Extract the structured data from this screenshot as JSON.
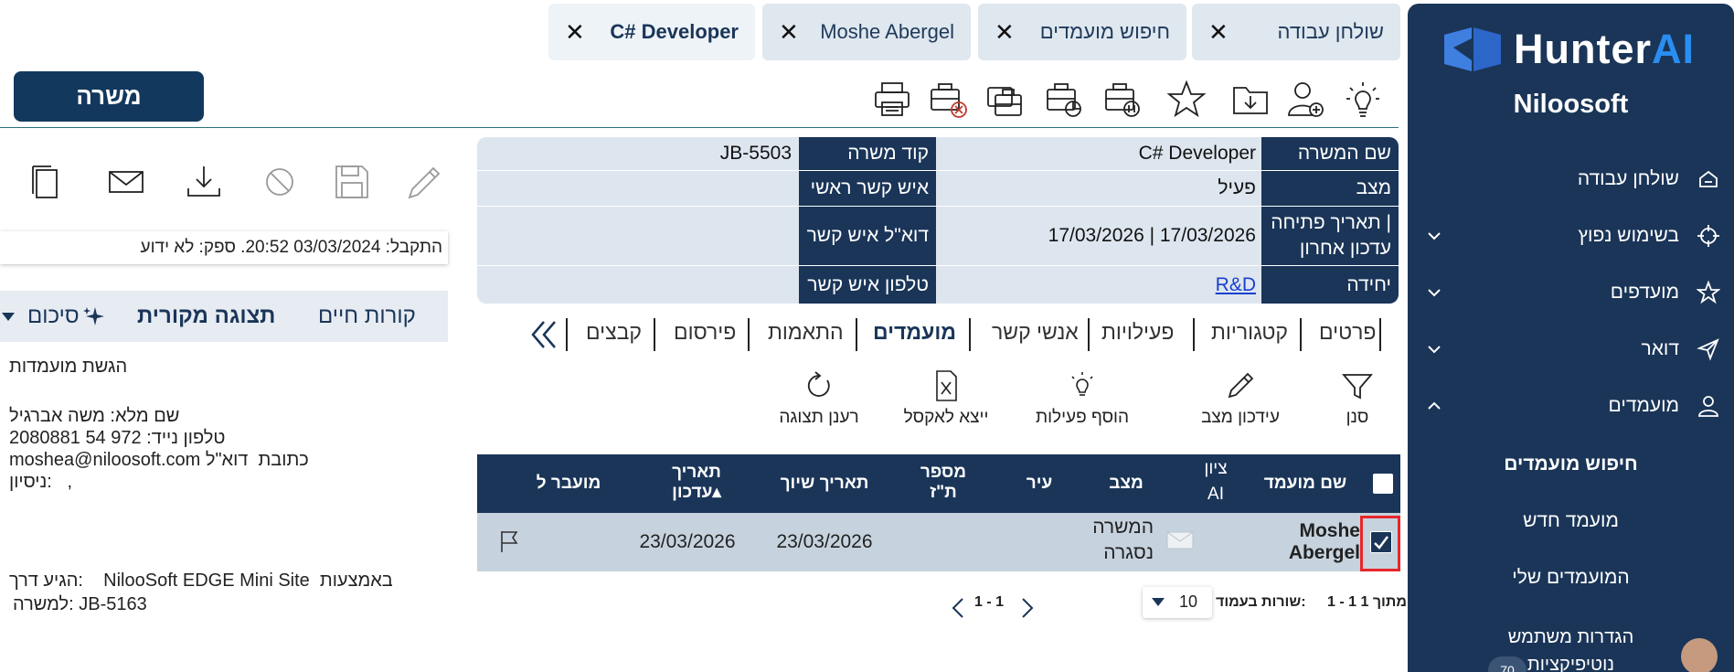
{
  "app": {
    "brand_main": "Hunter",
    "brand_ai": "AI",
    "org": "Niloosoft"
  },
  "sidebar": {
    "items": [
      {
        "label": "שולחן עבודה",
        "icon": "home-icon"
      },
      {
        "label": "בשימוש נפוץ",
        "icon": "crosshair-icon"
      },
      {
        "label": "מועדפים",
        "icon": "star-icon"
      },
      {
        "label": "דואר",
        "icon": "send-icon"
      },
      {
        "label": "מועמדים",
        "icon": "user-icon"
      }
    ],
    "subitems": [
      {
        "label": "חיפוש מועמדים"
      },
      {
        "label": "מועמד חדש"
      },
      {
        "label": "המועמדים שלי"
      }
    ],
    "user_settings": "הגדרות משתמש",
    "notifications": "נוטיפיקציות",
    "notifications_count": "70"
  },
  "tabs": [
    {
      "label": "C# Developer",
      "close": "✕"
    },
    {
      "label": "Moshe Abergel",
      "close": "✕"
    },
    {
      "label": "חיפוש מועמדים",
      "close": "✕"
    },
    {
      "label": "שולחן עבודה",
      "close": "✕"
    }
  ],
  "position_button": "משרה",
  "details": {
    "job_title_label": "שם המשרה",
    "job_title": "C# Developer",
    "job_code_label": "קוד משרה",
    "job_code": "JB-5503",
    "status_label": "מצב",
    "status": "פעיל",
    "contact_label": "איש קשר ראשי",
    "contact": "",
    "opened_label_1": "תאריך פתיחה |",
    "opened_label_2": "עדכון אחרון",
    "opened": "17/03/2026 | 17/03/2026",
    "contact_email_label": "דוא\"ל איש קשר",
    "contact_email": "",
    "unit_label": "יחידה",
    "unit": "R&D",
    "contact_phone_label": "טלפון איש קשר",
    "contact_phone": ""
  },
  "section_tabs": [
    "פרטים",
    "קטגוריות",
    "פעילויות",
    "אנשי קשר",
    "מועמדים",
    "התאמות",
    "פירסום",
    "קבצים"
  ],
  "actions": [
    "סנן",
    "עידכון מצב",
    "הוסף פעילות",
    "ייצא לאקסל",
    "רענן תצוגה"
  ],
  "grid": {
    "headers": {
      "name": "שם מועמד",
      "ai_1": "ציון",
      "ai_2": "AI",
      "status": "מצב",
      "city": "עיר",
      "id_1": "מספר",
      "id_2": "ת\"ז",
      "assign": "תאריך שיוך",
      "upd_1": "תאריך",
      "upd_2": "עדכון▴",
      "transfer": "מועבר ל"
    },
    "rows": [
      {
        "name_1": "Moshe",
        "name_2": "Abergel",
        "status_1": "המשרה",
        "status_2": "נסגרה",
        "assign": "23/03/2026",
        "updated": "23/03/2026",
        "checked": true
      }
    ]
  },
  "pager": {
    "range": "1 - 1",
    "of": "1 - 1 מתוך 1",
    "rows_label": "שורות בעמוד:",
    "rows_value": "10"
  },
  "preview": {
    "received": "התקבל: 03/03/2024 20:52. ספק: לא ידוע",
    "tab_cv": "קורות חיים",
    "tab_original": "תצוגה מקורית",
    "tab_summary": "סיכום",
    "lines": [
      "הגשת מועמדות",
      "שם מלא: משה אברגיל",
      "טלפון נייד: 972 54 2080881",
      "moshea@niloosoft.com כתובת  דוא\"ל",
      "ניסיון:   ,",
      "הגיע דרך:    NilooSoft EDGE Mini Site  באמצעות",
      "למשרה: JB-5163"
    ]
  }
}
